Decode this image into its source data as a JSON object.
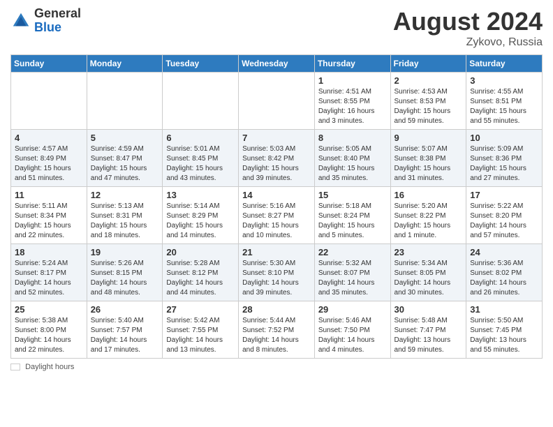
{
  "header": {
    "logo_general": "General",
    "logo_blue": "Blue",
    "month_year": "August 2024",
    "location": "Zykovo, Russia"
  },
  "days_of_week": [
    "Sunday",
    "Monday",
    "Tuesday",
    "Wednesday",
    "Thursday",
    "Friday",
    "Saturday"
  ],
  "weeks": [
    [
      {
        "day": "",
        "info": ""
      },
      {
        "day": "",
        "info": ""
      },
      {
        "day": "",
        "info": ""
      },
      {
        "day": "",
        "info": ""
      },
      {
        "day": "1",
        "info": "Sunrise: 4:51 AM\nSunset: 8:55 PM\nDaylight: 16 hours\nand 3 minutes."
      },
      {
        "day": "2",
        "info": "Sunrise: 4:53 AM\nSunset: 8:53 PM\nDaylight: 15 hours\nand 59 minutes."
      },
      {
        "day": "3",
        "info": "Sunrise: 4:55 AM\nSunset: 8:51 PM\nDaylight: 15 hours\nand 55 minutes."
      }
    ],
    [
      {
        "day": "4",
        "info": "Sunrise: 4:57 AM\nSunset: 8:49 PM\nDaylight: 15 hours\nand 51 minutes."
      },
      {
        "day": "5",
        "info": "Sunrise: 4:59 AM\nSunset: 8:47 PM\nDaylight: 15 hours\nand 47 minutes."
      },
      {
        "day": "6",
        "info": "Sunrise: 5:01 AM\nSunset: 8:45 PM\nDaylight: 15 hours\nand 43 minutes."
      },
      {
        "day": "7",
        "info": "Sunrise: 5:03 AM\nSunset: 8:42 PM\nDaylight: 15 hours\nand 39 minutes."
      },
      {
        "day": "8",
        "info": "Sunrise: 5:05 AM\nSunset: 8:40 PM\nDaylight: 15 hours\nand 35 minutes."
      },
      {
        "day": "9",
        "info": "Sunrise: 5:07 AM\nSunset: 8:38 PM\nDaylight: 15 hours\nand 31 minutes."
      },
      {
        "day": "10",
        "info": "Sunrise: 5:09 AM\nSunset: 8:36 PM\nDaylight: 15 hours\nand 27 minutes."
      }
    ],
    [
      {
        "day": "11",
        "info": "Sunrise: 5:11 AM\nSunset: 8:34 PM\nDaylight: 15 hours\nand 22 minutes."
      },
      {
        "day": "12",
        "info": "Sunrise: 5:13 AM\nSunset: 8:31 PM\nDaylight: 15 hours\nand 18 minutes."
      },
      {
        "day": "13",
        "info": "Sunrise: 5:14 AM\nSunset: 8:29 PM\nDaylight: 15 hours\nand 14 minutes."
      },
      {
        "day": "14",
        "info": "Sunrise: 5:16 AM\nSunset: 8:27 PM\nDaylight: 15 hours\nand 10 minutes."
      },
      {
        "day": "15",
        "info": "Sunrise: 5:18 AM\nSunset: 8:24 PM\nDaylight: 15 hours\nand 5 minutes."
      },
      {
        "day": "16",
        "info": "Sunrise: 5:20 AM\nSunset: 8:22 PM\nDaylight: 15 hours\nand 1 minute."
      },
      {
        "day": "17",
        "info": "Sunrise: 5:22 AM\nSunset: 8:20 PM\nDaylight: 14 hours\nand 57 minutes."
      }
    ],
    [
      {
        "day": "18",
        "info": "Sunrise: 5:24 AM\nSunset: 8:17 PM\nDaylight: 14 hours\nand 52 minutes."
      },
      {
        "day": "19",
        "info": "Sunrise: 5:26 AM\nSunset: 8:15 PM\nDaylight: 14 hours\nand 48 minutes."
      },
      {
        "day": "20",
        "info": "Sunrise: 5:28 AM\nSunset: 8:12 PM\nDaylight: 14 hours\nand 44 minutes."
      },
      {
        "day": "21",
        "info": "Sunrise: 5:30 AM\nSunset: 8:10 PM\nDaylight: 14 hours\nand 39 minutes."
      },
      {
        "day": "22",
        "info": "Sunrise: 5:32 AM\nSunset: 8:07 PM\nDaylight: 14 hours\nand 35 minutes."
      },
      {
        "day": "23",
        "info": "Sunrise: 5:34 AM\nSunset: 8:05 PM\nDaylight: 14 hours\nand 30 minutes."
      },
      {
        "day": "24",
        "info": "Sunrise: 5:36 AM\nSunset: 8:02 PM\nDaylight: 14 hours\nand 26 minutes."
      }
    ],
    [
      {
        "day": "25",
        "info": "Sunrise: 5:38 AM\nSunset: 8:00 PM\nDaylight: 14 hours\nand 22 minutes."
      },
      {
        "day": "26",
        "info": "Sunrise: 5:40 AM\nSunset: 7:57 PM\nDaylight: 14 hours\nand 17 minutes."
      },
      {
        "day": "27",
        "info": "Sunrise: 5:42 AM\nSunset: 7:55 PM\nDaylight: 14 hours\nand 13 minutes."
      },
      {
        "day": "28",
        "info": "Sunrise: 5:44 AM\nSunset: 7:52 PM\nDaylight: 14 hours\nand 8 minutes."
      },
      {
        "day": "29",
        "info": "Sunrise: 5:46 AM\nSunset: 7:50 PM\nDaylight: 14 hours\nand 4 minutes."
      },
      {
        "day": "30",
        "info": "Sunrise: 5:48 AM\nSunset: 7:47 PM\nDaylight: 13 hours\nand 59 minutes."
      },
      {
        "day": "31",
        "info": "Sunrise: 5:50 AM\nSunset: 7:45 PM\nDaylight: 13 hours\nand 55 minutes."
      }
    ]
  ],
  "footer": {
    "daylight_label": "Daylight hours"
  }
}
